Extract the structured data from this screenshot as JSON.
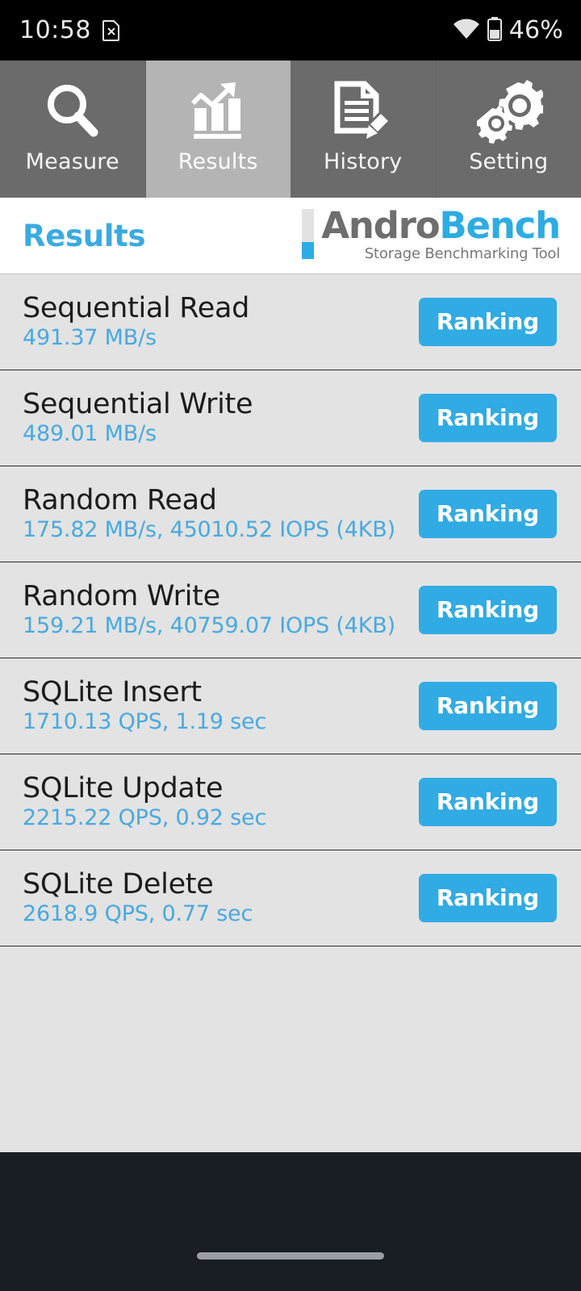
{
  "statusbar": {
    "clock": "10:58",
    "sim_icon": "sim-card-disabled-icon",
    "wifi_icon": "wifi-icon",
    "battery_icon": "battery-icon",
    "battery_percent": "46%"
  },
  "tabs": [
    {
      "label": "Measure",
      "icon": "magnifier-icon",
      "selected": false
    },
    {
      "label": "Results",
      "icon": "bar-chart-arrow-icon",
      "selected": true
    },
    {
      "label": "History",
      "icon": "document-pencil-icon",
      "selected": false
    },
    {
      "label": "Setting",
      "icon": "gears-icon",
      "selected": false
    }
  ],
  "header": {
    "title": "Results",
    "logo_primary": "Andro",
    "logo_secondary": "Bench",
    "logo_tagline": "Storage Benchmarking Tool"
  },
  "results": {
    "button_label": "Ranking",
    "rows": [
      {
        "name": "Sequential Read",
        "value": "491.37 MB/s"
      },
      {
        "name": "Sequential Write",
        "value": "489.01 MB/s"
      },
      {
        "name": "Random Read",
        "value": "175.82 MB/s, 45010.52 IOPS (4KB)"
      },
      {
        "name": "Random Write",
        "value": "159.21 MB/s, 40759.07 IOPS (4KB)"
      },
      {
        "name": "SQLite Insert",
        "value": "1710.13 QPS, 1.19 sec"
      },
      {
        "name": "SQLite Update",
        "value": "2215.22 QPS, 0.92 sec"
      },
      {
        "name": "SQLite Delete",
        "value": "2618.9 QPS, 0.77 sec"
      }
    ]
  },
  "navbar": {
    "home_indicator": "home-indicator"
  },
  "colors": {
    "accent_blue": "#31abe3",
    "value_blue": "#49a9e0",
    "tab_bg": "#6b6b6b",
    "tab_selected_bg": "#b4b4b4",
    "list_bg": "#e3e3e3",
    "navbar_bg": "#191d24"
  }
}
